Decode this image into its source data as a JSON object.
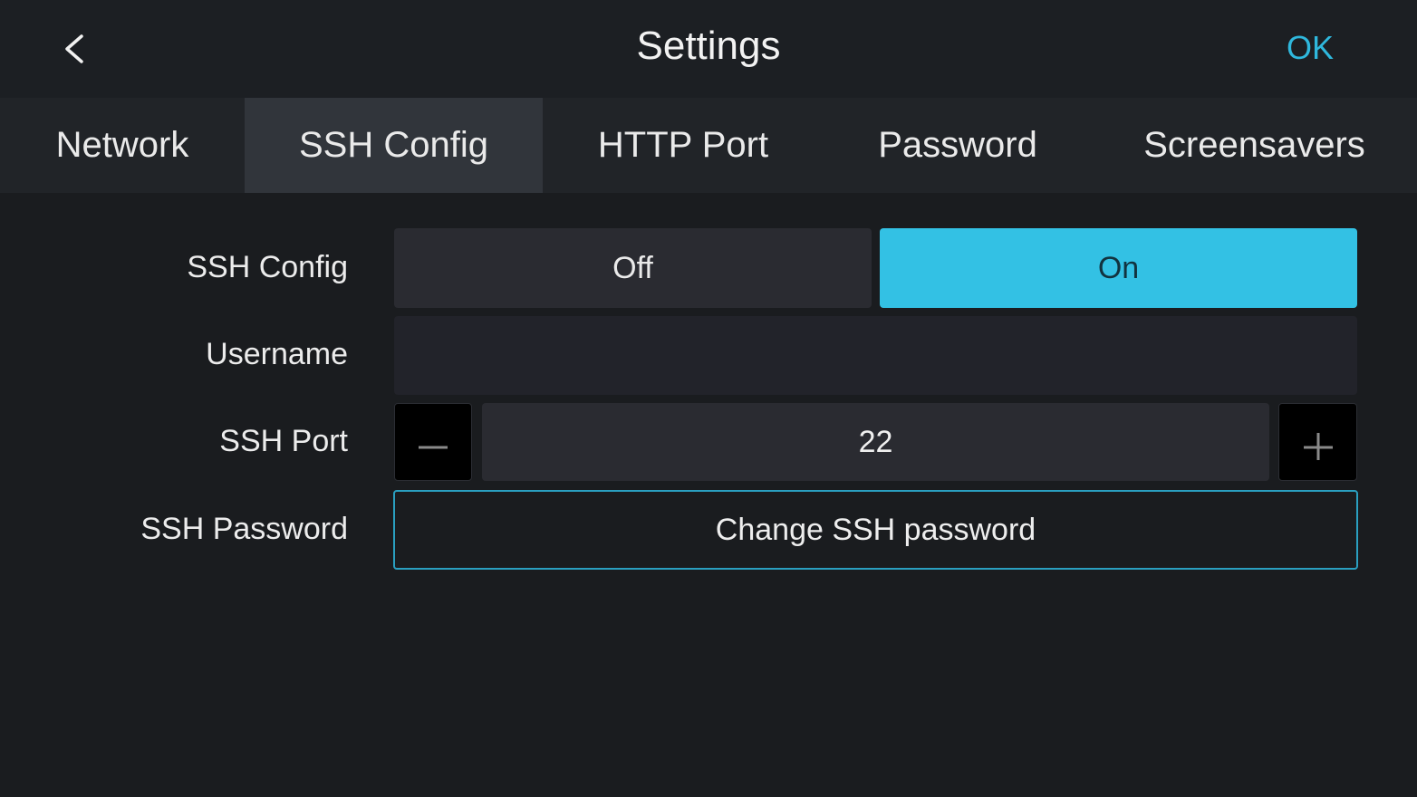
{
  "header": {
    "title": "Settings",
    "ok_label": "OK",
    "back_icon": "chevron-left-icon"
  },
  "tabs": [
    {
      "label": "Network",
      "active": false
    },
    {
      "label": "SSH Config",
      "active": true
    },
    {
      "label": "HTTP Port",
      "active": false
    },
    {
      "label": "Password",
      "active": false
    },
    {
      "label": "Screensavers",
      "active": false
    }
  ],
  "form": {
    "ssh_config": {
      "label": "SSH Config",
      "off_label": "Off",
      "on_label": "On",
      "selected": "On"
    },
    "username": {
      "label": "Username",
      "value": ""
    },
    "ssh_port": {
      "label": "SSH Port",
      "value": "22",
      "decrement_icon": "minus-icon",
      "increment_icon": "plus-icon"
    },
    "ssh_password": {
      "label": "SSH Password",
      "button_label": "Change SSH password"
    }
  },
  "colors": {
    "accent": "#33c1e4",
    "ok_text": "#2fb8dd",
    "background": "#1a1c1f"
  }
}
